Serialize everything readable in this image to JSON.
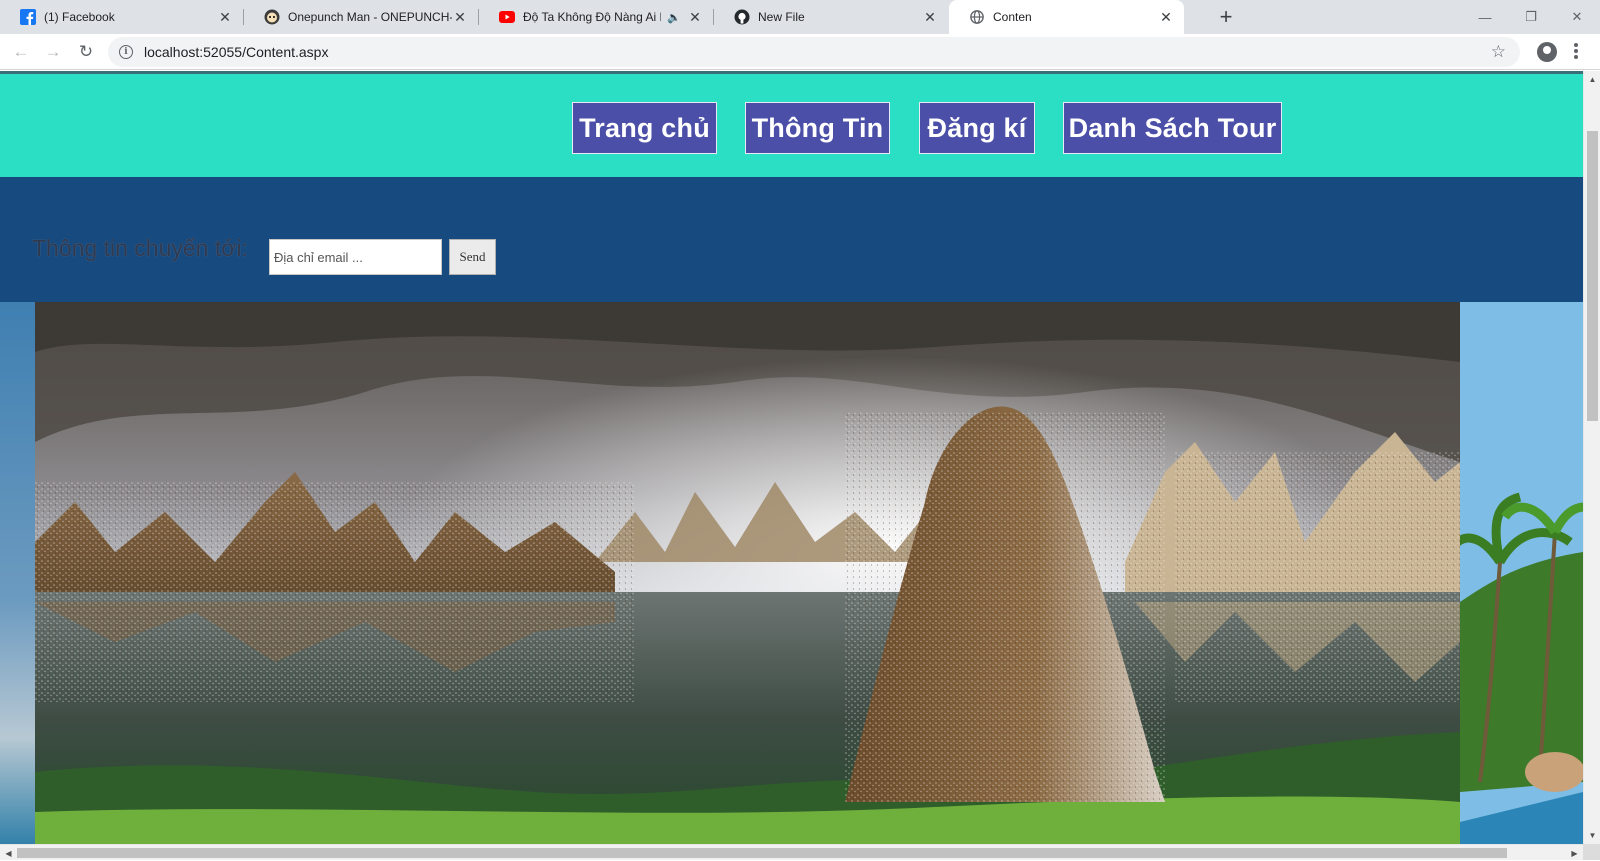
{
  "browser": {
    "tabs": [
      {
        "title": "(1) Facebook",
        "icon": "facebook-icon",
        "close": "✕"
      },
      {
        "title": "Onepunch Man - ONEPUNCH-M",
        "icon": "onepunch-icon",
        "close": "✕"
      },
      {
        "title": "Độ Ta Không Độ Nàng Ai Là",
        "icon": "youtube-icon",
        "sound": "🔈",
        "close": "✕"
      },
      {
        "title": "New File",
        "icon": "github-icon",
        "close": "✕"
      },
      {
        "title": "Conten",
        "icon": "globe-icon",
        "close": "✕",
        "active": true
      }
    ],
    "new_tab": "+",
    "window_controls": {
      "minimize": "—",
      "maximize": "❐",
      "close": "✕"
    },
    "address_bar": {
      "url": "localhost:52055/Content.aspx",
      "info": "i",
      "star": "☆"
    },
    "nav": {
      "back": "←",
      "forward": "→",
      "reload": "↻"
    }
  },
  "page": {
    "nav_links": [
      "Trang chủ",
      "Thông Tin",
      "Đăng kí",
      "Danh Sách Tour"
    ],
    "subscribe": {
      "label": "Thông tin chuyến tới:",
      "placeholder": "Địa chỉ email ...",
      "button": "Send"
    }
  },
  "scrollbars": {
    "up": "▲",
    "down": "▼",
    "left": "◀",
    "right": "▶"
  },
  "colors": {
    "topbar": "#2bdfc4",
    "nav_button": "#4b4fa7",
    "subscribe_bar": "#174a7e",
    "tab_strip": "#dee1e6"
  }
}
